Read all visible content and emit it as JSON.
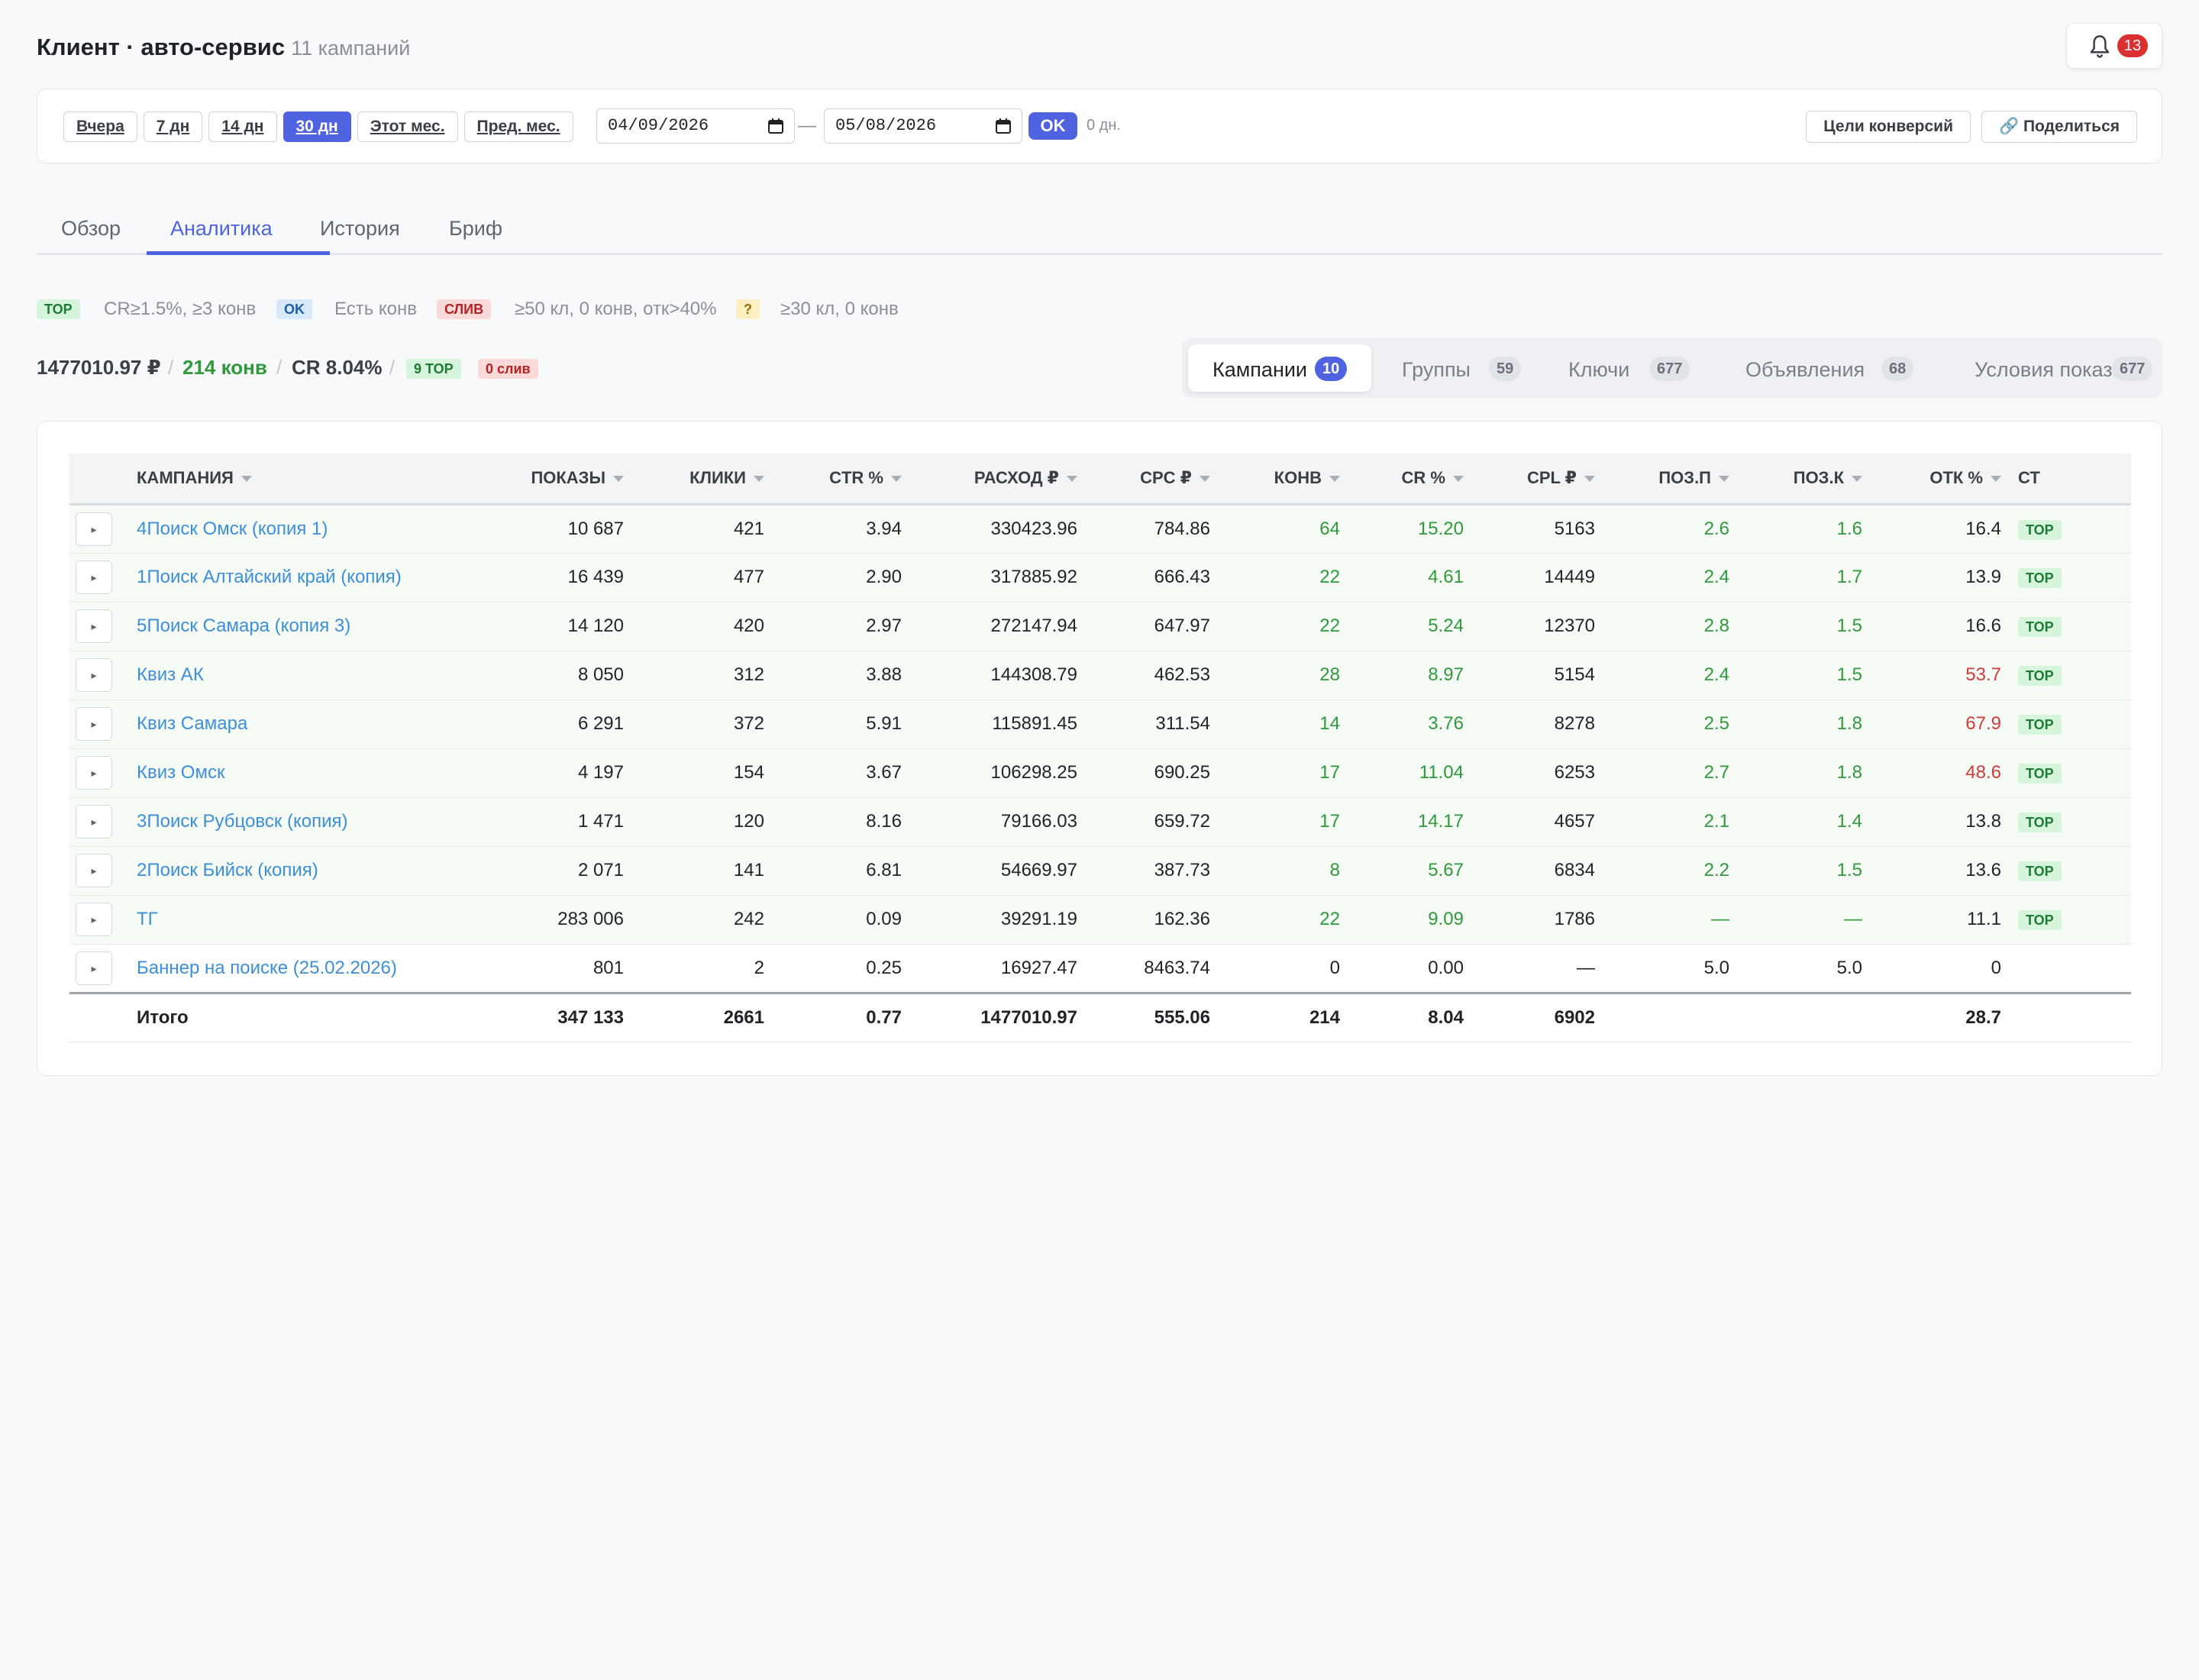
{
  "header": {
    "title": "Клиент · авто-сервис",
    "subtitle": "11 кампаний",
    "notifications": "13"
  },
  "toolbar": {
    "periods": [
      "Вчера",
      "7 дн",
      "14 дн",
      "30 дн",
      "Этот мес.",
      "Пред. мес."
    ],
    "active_period": "30 дн",
    "date_from": "04/09/2026",
    "date_separator": "—",
    "date_to": "05/08/2026",
    "ok_label": "OK",
    "days_label": "0 дн.",
    "goals_label": "Цели конверсий",
    "share_label": "🔗 Поделиться"
  },
  "tabs": {
    "items": [
      "Обзор",
      "Аналитика",
      "История",
      "Бриф"
    ],
    "active": "Аналитика"
  },
  "legend": [
    {
      "badge": "TOP",
      "text": "CR≥1.5%, ≥3 конв",
      "color": "#1e7b34"
    },
    {
      "badge": "OK",
      "text": "Есть конв",
      "color": "#1c5ea8"
    },
    {
      "badge": "СЛИВ",
      "text": "≥50 кл, 0 конв, отк>40%",
      "color": "#b42323"
    },
    {
      "badge": "?",
      "text": "≥30 кл, 0 конв",
      "color": "#9b6c00"
    }
  ],
  "summary": {
    "spend": "1477010.97 ₽",
    "conversions": "214 конв",
    "cr": "CR 8.04%",
    "top_badge": "9 TOP",
    "sliv_badge": "0 слив",
    "separator": "/"
  },
  "switcher": {
    "items": [
      {
        "label": "Кампании",
        "count": "10"
      },
      {
        "label": "Группы",
        "count": "59"
      },
      {
        "label": "Ключи",
        "count": "677"
      },
      {
        "label": "Объявления",
        "count": "68"
      },
      {
        "label": "Условия показа",
        "count": "677"
      }
    ],
    "active": "Кампании"
  },
  "table": {
    "columns": [
      "КАМПАНИЯ",
      "ПОКАЗЫ",
      "КЛИКИ",
      "CTR %",
      "РАСХОД ₽",
      "CPC ₽",
      "КОНВ",
      "CR %",
      "CPL ₽",
      "ПОЗ.П",
      "ПОЗ.К",
      "ОТК %",
      "СТ"
    ],
    "expand_glyph": "▸",
    "rows": [
      {
        "campaign": "4Поиск Омск (копия 1)",
        "shows": "10 687",
        "clicks": "421",
        "ctr": "3.94",
        "spend": "330423.96",
        "cpc": "784.86",
        "conv": "64",
        "cr": "15.20",
        "cpl": "5163",
        "pos_p": "2.6",
        "pos_k": "1.6",
        "otk": "16.4",
        "st": "TOP"
      },
      {
        "campaign": "1Поиск Алтайский край (копия)",
        "shows": "16 439",
        "clicks": "477",
        "ctr": "2.90",
        "spend": "317885.92",
        "cpc": "666.43",
        "conv": "22",
        "cr": "4.61",
        "cpl": "14449",
        "pos_p": "2.4",
        "pos_k": "1.7",
        "otk": "13.9",
        "st": "TOP"
      },
      {
        "campaign": "5Поиск Самара (копия 3)",
        "shows": "14 120",
        "clicks": "420",
        "ctr": "2.97",
        "spend": "272147.94",
        "cpc": "647.97",
        "conv": "22",
        "cr": "5.24",
        "cpl": "12370",
        "pos_p": "2.8",
        "pos_k": "1.5",
        "otk": "16.6",
        "st": "TOP"
      },
      {
        "campaign": "Квиз АК",
        "shows": "8 050",
        "clicks": "312",
        "ctr": "3.88",
        "spend": "144308.79",
        "cpc": "462.53",
        "conv": "28",
        "cr": "8.97",
        "cpl": "5154",
        "pos_p": "2.4",
        "pos_k": "1.5",
        "otk": "53.7",
        "st": "TOP"
      },
      {
        "campaign": "Квиз Самара",
        "shows": "6 291",
        "clicks": "372",
        "ctr": "5.91",
        "spend": "115891.45",
        "cpc": "311.54",
        "conv": "14",
        "cr": "3.76",
        "cpl": "8278",
        "pos_p": "2.5",
        "pos_k": "1.8",
        "otk": "67.9",
        "st": "TOP"
      },
      {
        "campaign": "Квиз Омск",
        "shows": "4 197",
        "clicks": "154",
        "ctr": "3.67",
        "spend": "106298.25",
        "cpc": "690.25",
        "conv": "17",
        "cr": "11.04",
        "cpl": "6253",
        "pos_p": "2.7",
        "pos_k": "1.8",
        "otk": "48.6",
        "st": "TOP"
      },
      {
        "campaign": "3Поиск Рубцовск (копия)",
        "shows": "1 471",
        "clicks": "120",
        "ctr": "8.16",
        "spend": "79166.03",
        "cpc": "659.72",
        "conv": "17",
        "cr": "14.17",
        "cpl": "4657",
        "pos_p": "2.1",
        "pos_k": "1.4",
        "otk": "13.8",
        "st": "TOP"
      },
      {
        "campaign": "2Поиск Бийск (копия)",
        "shows": "2 071",
        "clicks": "141",
        "ctr": "6.81",
        "spend": "54669.97",
        "cpc": "387.73",
        "conv": "8",
        "cr": "5.67",
        "cpl": "6834",
        "pos_p": "2.2",
        "pos_k": "1.5",
        "otk": "13.6",
        "st": "TOP"
      },
      {
        "campaign": "ТГ",
        "shows": "283 006",
        "clicks": "242",
        "ctr": "0.09",
        "spend": "39291.19",
        "cpc": "162.36",
        "conv": "22",
        "cr": "9.09",
        "cpl": "1786",
        "pos_p": "—",
        "pos_k": "—",
        "otk": "11.1",
        "st": "TOP"
      },
      {
        "campaign": "Баннер на поиске (25.02.2026)",
        "shows": "801",
        "clicks": "2",
        "ctr": "0.25",
        "spend": "16927.47",
        "cpc": "8463.74",
        "conv": "0",
        "cr": "0.00",
        "cpl": "—",
        "pos_p": "5.0",
        "pos_k": "5.0",
        "otk": "0",
        "st": ""
      }
    ],
    "totals": {
      "label": "Итого",
      "shows": "347 133",
      "clicks": "2661",
      "ctr": "0.77",
      "spend": "1477010.97",
      "cpc": "555.06",
      "conv": "214",
      "cr": "8.04",
      "cpl": "6902",
      "pos_p": "",
      "pos_k": "",
      "otk": "28.7",
      "st": ""
    }
  }
}
